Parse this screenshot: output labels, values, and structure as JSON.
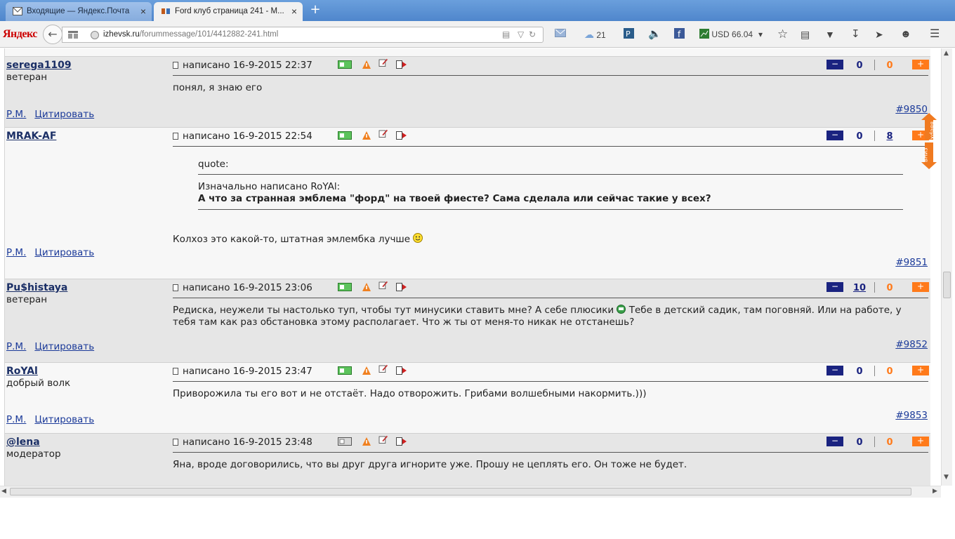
{
  "tabs": [
    {
      "title": "Входящие — Яндекс.Почта",
      "active": false
    },
    {
      "title": "Ford клуб страница 241 - M...",
      "active": true
    }
  ],
  "toolbar": {
    "logo": "Яндекс",
    "url_host": "izhevsk.ru",
    "url_path": "/forummessage/101/4412882-241.html",
    "weather": "21",
    "currency": "USD 66.04"
  },
  "posts": [
    {
      "author": "serega1109",
      "rank": "ветеран",
      "date": "написано 16-9-2015 22:37",
      "body": "понял, я знаю его",
      "minus": "0",
      "plus": "0",
      "num": "#9850"
    },
    {
      "author": "MRAK-AF",
      "rank": "",
      "date": "написано 16-9-2015 22:54",
      "quote_label": "quote:",
      "quote_by": "Изначально написано RoYAl:",
      "quote_text": "А что за странная эмблема \"форд\" на твоей фиесте? Сама сделала или сейчас такие у всех?",
      "body": "Колхоз это какой-то, штатная эмлембка лучше",
      "minus": "0",
      "plus": "8",
      "num": "#9851"
    },
    {
      "author": "Pu$histaya",
      "rank": "ветеран",
      "date": "написано 16-9-2015 23:06",
      "body_line1a": "Редиска, неужели ты настолько туп, чтобы тут минусики ставить мне? А себе плюсики",
      "body_line1b": "Тебе в детский садик, там поговняй. Или на работе, у",
      "body_line2": "тебя там как раз обстановка этому располагает. Что ж ты от меня-то никак не отстанешь?",
      "minus": "10",
      "plus": "0",
      "num": "#9852"
    },
    {
      "author": "RoYAl",
      "rank": "добрый волк",
      "date": "написано 16-9-2015 23:47",
      "body": "Приворожила ты его вот и не отстаёт. Надо отворожить. Грибами волшебными накормить.)))",
      "minus": "0",
      "plus": "0",
      "num": "#9853"
    },
    {
      "author": "@lena",
      "rank": "модератор",
      "date": "написано 16-9-2015 23:48",
      "body": "Яна, вроде договорились, что вы друг друга игнорите уже. Прошу не цеплять его. Он тоже не будет.",
      "minus": "0",
      "plus": "0"
    }
  ],
  "post_links": {
    "pm": "Р.М.",
    "quote": "Цитировать"
  },
  "updown": {
    "up": "вверх",
    "down": "вниз"
  },
  "vote_labels": {
    "minus": "−",
    "plus": "+"
  }
}
